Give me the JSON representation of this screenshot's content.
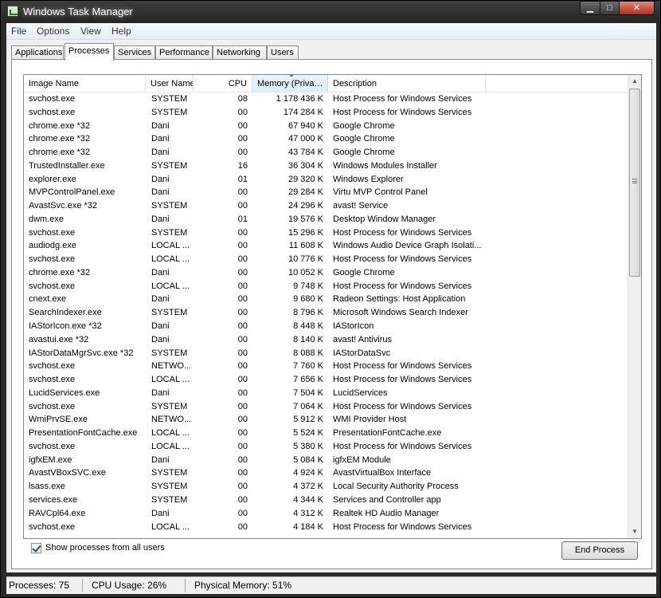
{
  "window": {
    "title": "Windows Task Manager"
  },
  "menu": [
    "File",
    "Options",
    "View",
    "Help"
  ],
  "tabs": [
    "Applications",
    "Processes",
    "Services",
    "Performance",
    "Networking",
    "Users"
  ],
  "active_tab": "Processes",
  "columns": {
    "name": "Image Name",
    "user": "User Name",
    "cpu": "CPU",
    "memory": "Memory (Priva…",
    "description": "Description"
  },
  "processes": [
    {
      "name": "svchost.exe",
      "user": "SYSTEM",
      "cpu": "08",
      "memory": "1 178 436 K",
      "description": "Host Process for Windows Services"
    },
    {
      "name": "svchost.exe",
      "user": "SYSTEM",
      "cpu": "00",
      "memory": "174 284 K",
      "description": "Host Process for Windows Services"
    },
    {
      "name": "chrome.exe *32",
      "user": "Dani",
      "cpu": "00",
      "memory": "67 940 K",
      "description": "Google Chrome"
    },
    {
      "name": "chrome.exe *32",
      "user": "Dani",
      "cpu": "00",
      "memory": "47 000 K",
      "description": "Google Chrome"
    },
    {
      "name": "chrome.exe *32",
      "user": "Dani",
      "cpu": "00",
      "memory": "43 784 K",
      "description": "Google Chrome"
    },
    {
      "name": "TrustedInstaller.exe",
      "user": "SYSTEM",
      "cpu": "16",
      "memory": "36 304 K",
      "description": "Windows Modules Installer"
    },
    {
      "name": "explorer.exe",
      "user": "Dani",
      "cpu": "01",
      "memory": "29 320 K",
      "description": "Windows Explorer"
    },
    {
      "name": "MVPControlPanel.exe",
      "user": "Dani",
      "cpu": "00",
      "memory": "29 284 K",
      "description": "Virtu MVP Control Panel"
    },
    {
      "name": "AvastSvc.exe *32",
      "user": "SYSTEM",
      "cpu": "00",
      "memory": "24 296 K",
      "description": "avast! Service"
    },
    {
      "name": "dwm.exe",
      "user": "Dani",
      "cpu": "01",
      "memory": "19 576 K",
      "description": "Desktop Window Manager"
    },
    {
      "name": "svchost.exe",
      "user": "SYSTEM",
      "cpu": "00",
      "memory": "15 296 K",
      "description": "Host Process for Windows Services"
    },
    {
      "name": "audiodg.exe",
      "user": "LOCAL ...",
      "cpu": "00",
      "memory": "11 608 K",
      "description": "Windows Audio Device Graph Isolati..."
    },
    {
      "name": "svchost.exe",
      "user": "LOCAL ...",
      "cpu": "00",
      "memory": "10 776 K",
      "description": "Host Process for Windows Services"
    },
    {
      "name": "chrome.exe *32",
      "user": "Dani",
      "cpu": "00",
      "memory": "10 052 K",
      "description": "Google Chrome"
    },
    {
      "name": "svchost.exe",
      "user": "LOCAL ...",
      "cpu": "00",
      "memory": "9 748 K",
      "description": "Host Process for Windows Services"
    },
    {
      "name": "cnext.exe",
      "user": "Dani",
      "cpu": "00",
      "memory": "9 680 K",
      "description": "Radeon Settings: Host Application"
    },
    {
      "name": "SearchIndexer.exe",
      "user": "SYSTEM",
      "cpu": "00",
      "memory": "8 796 K",
      "description": "Microsoft Windows Search Indexer"
    },
    {
      "name": "IAStorIcon.exe *32",
      "user": "Dani",
      "cpu": "00",
      "memory": "8 448 K",
      "description": "IAStorIcon"
    },
    {
      "name": "avastui.exe *32",
      "user": "Dani",
      "cpu": "00",
      "memory": "8 140 K",
      "description": "avast! Antivirus"
    },
    {
      "name": "IAStorDataMgrSvc.exe *32",
      "user": "SYSTEM",
      "cpu": "00",
      "memory": "8 088 K",
      "description": "IAStorDataSvc"
    },
    {
      "name": "svchost.exe",
      "user": "NETWO...",
      "cpu": "00",
      "memory": "7 760 K",
      "description": "Host Process for Windows Services"
    },
    {
      "name": "svchost.exe",
      "user": "LOCAL ...",
      "cpu": "00",
      "memory": "7 656 K",
      "description": "Host Process for Windows Services"
    },
    {
      "name": "LucidServices.exe",
      "user": "Dani",
      "cpu": "00",
      "memory": "7 504 K",
      "description": "LucidServices"
    },
    {
      "name": "svchost.exe",
      "user": "SYSTEM",
      "cpu": "00",
      "memory": "7 064 K",
      "description": "Host Process for Windows Services"
    },
    {
      "name": "WmiPrvSE.exe",
      "user": "NETWO...",
      "cpu": "00",
      "memory": "5 912 K",
      "description": "WMI Provider Host"
    },
    {
      "name": "PresentationFontCache.exe",
      "user": "LOCAL ...",
      "cpu": "00",
      "memory": "5 524 K",
      "description": "PresentationFontCache.exe"
    },
    {
      "name": "svchost.exe",
      "user": "LOCAL ...",
      "cpu": "00",
      "memory": "5 380 K",
      "description": "Host Process for Windows Services"
    },
    {
      "name": "igfxEM.exe",
      "user": "Dani",
      "cpu": "00",
      "memory": "5 084 K",
      "description": "igfxEM Module"
    },
    {
      "name": "AvastVBoxSVC.exe",
      "user": "SYSTEM",
      "cpu": "00",
      "memory": "4 924 K",
      "description": "AvastVirtualBox Interface"
    },
    {
      "name": "lsass.exe",
      "user": "SYSTEM",
      "cpu": "00",
      "memory": "4 372 K",
      "description": "Local Security Authority Process"
    },
    {
      "name": "services.exe",
      "user": "SYSTEM",
      "cpu": "00",
      "memory": "4 344 K",
      "description": "Services and Controller app"
    },
    {
      "name": "RAVCpl64.exe",
      "user": "Dani",
      "cpu": "00",
      "memory": "4 312 K",
      "description": "Realtek HD Audio Manager"
    },
    {
      "name": "svchost.exe",
      "user": "LOCAL ...",
      "cpu": "00",
      "memory": "4 184 K",
      "description": "Host Process for Windows Services"
    }
  ],
  "show_all_users": {
    "label": "Show processes from all users",
    "checked": true
  },
  "end_process_label": "End Process",
  "status": {
    "processes": "Processes: 75",
    "cpu_usage": "CPU Usage: 26%",
    "physical_memory": "Physical Memory: 51%"
  }
}
